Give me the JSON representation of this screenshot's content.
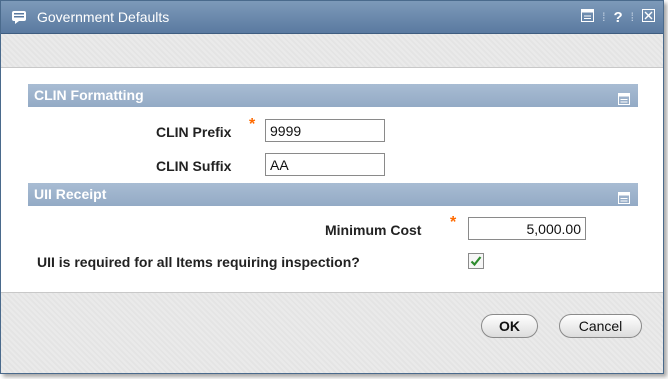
{
  "window": {
    "title": "Government Defaults",
    "title_icon": "dialog-icon",
    "controls": {
      "minimize_icon": "collapse-icon",
      "help_label": "?",
      "close_icon": "close-icon"
    }
  },
  "clin_section": {
    "header": "CLIN Formatting",
    "prefix_label": "CLIN Prefix",
    "prefix_required_mark": "*",
    "prefix_value": "9999",
    "suffix_label": "CLIN Suffix",
    "suffix_value": "AA"
  },
  "uii_section": {
    "header": "UII Receipt",
    "min_cost_label": "Minimum Cost",
    "min_cost_required_mark": "*",
    "min_cost_value": "5,000.00",
    "uii_required_label": "UII is required for all Items requiring inspection?",
    "uii_required_checked": true
  },
  "footer": {
    "ok_label": "OK",
    "cancel_label": "Cancel"
  },
  "colors": {
    "titlebar": "#6a89ad",
    "section_header": "#9db2cc",
    "required": "#ff6a00",
    "checkmark": "#2e8b2e"
  }
}
